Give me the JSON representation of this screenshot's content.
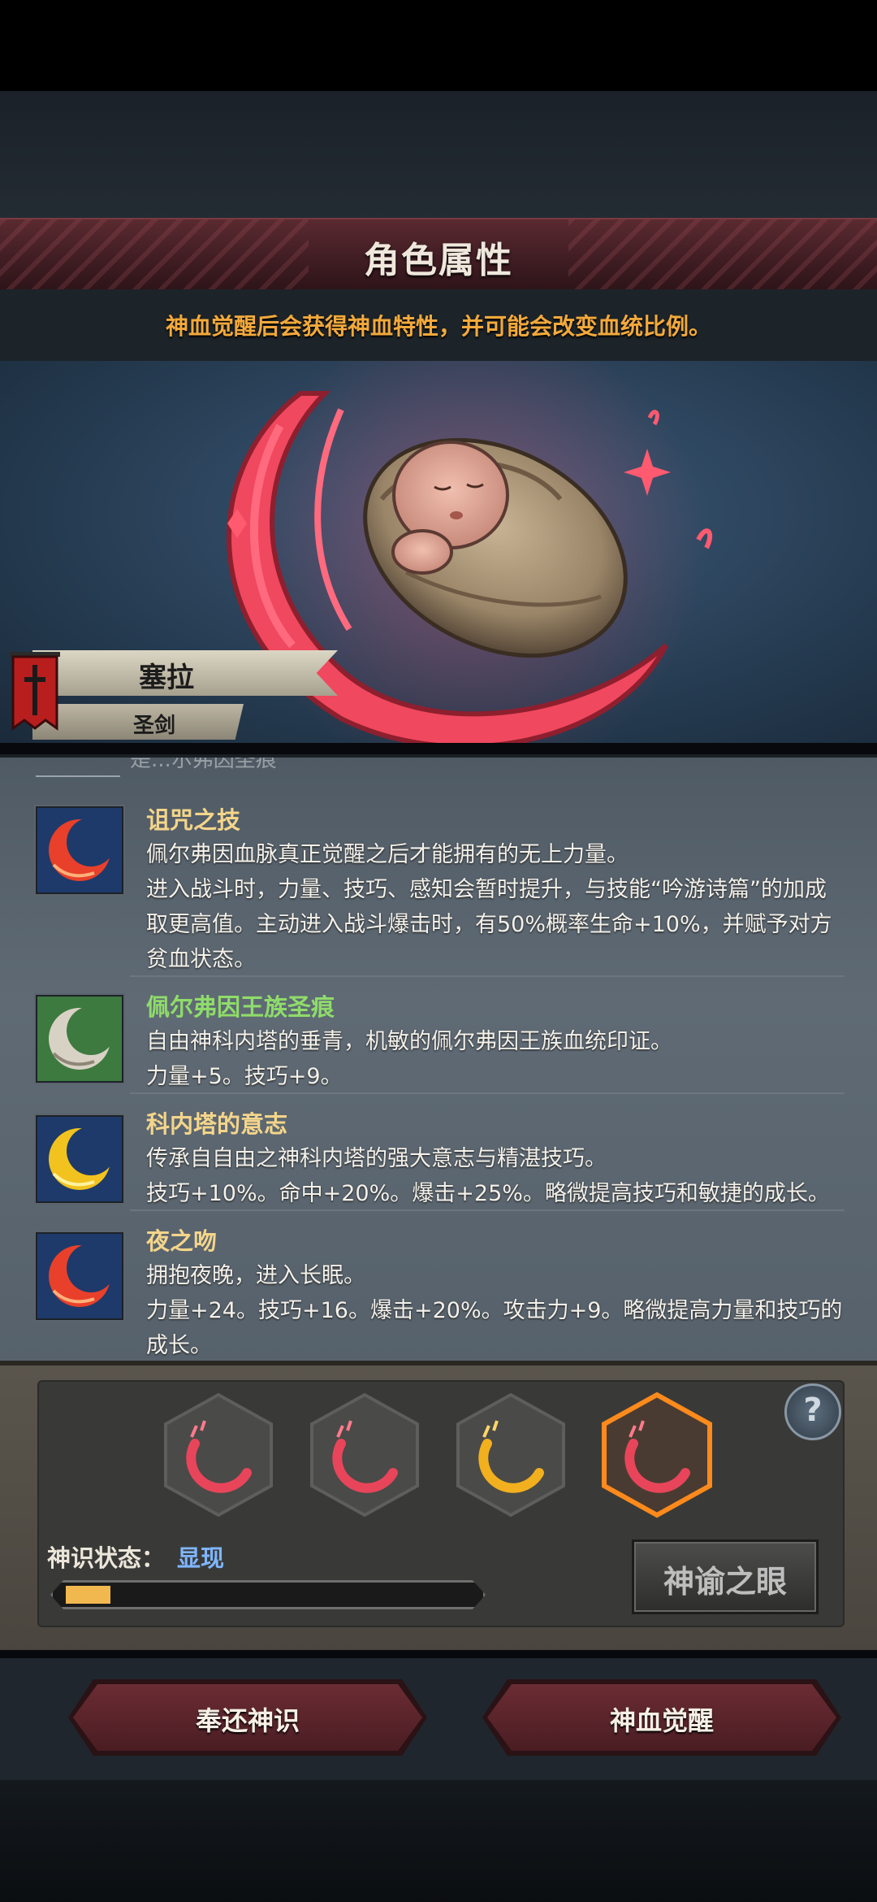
{
  "header": {
    "title": "角色属性",
    "hint": "神血觉醒后会获得神血特性，并可能会改变血统比例。"
  },
  "character": {
    "name": "塞拉",
    "class": "圣剑"
  },
  "traits_panel": {
    "faded_prev_line": "是...尔弗因圣痕",
    "traits": [
      {
        "name": "诅咒之技",
        "name_color": "#f4d58a",
        "icon": "red-flame-crescent-icon",
        "desc": "佩尔弗因血脉真正觉醒之后才能拥有的无上力量。\n进入战斗时，力量、技巧、感知会暂时提升，与技能“吟游诗篇”的加成取更高值。主动进入战斗爆击时，有50%概率生命+10%，并赋予对方贫血状态。"
      },
      {
        "name": "佩尔弗因王族圣痕",
        "name_color": "#8fdc6a",
        "icon": "white-flame-crescent-icon",
        "desc": "自由神科内塔的垂青，机敏的佩尔弗因王族血统印证。\n力量+5。技巧+9。"
      },
      {
        "name": "科内塔的意志",
        "name_color": "#f4d58a",
        "icon": "gold-flame-crescent-icon",
        "desc": "传承自自由之神科内塔的强大意志与精湛技巧。\n技巧+10%。命中+20%。爆击+25%。略微提高技巧和敏捷的成长。"
      },
      {
        "name": "夜之吻",
        "name_color": "#f4d58a",
        "icon": "red-flame-crescent-icon",
        "desc": "拥抱夜晚，进入长眠。\n力量+24。技巧+16。爆击+20%。攻击力+9。略微提高力量和技巧的成长。"
      }
    ]
  },
  "awakening": {
    "slots": [
      {
        "icon": "red-crescent-sigil-icon",
        "color": "#e8455a",
        "selected": false
      },
      {
        "icon": "red-crescent-sigil-icon",
        "color": "#e8455a",
        "selected": false
      },
      {
        "icon": "gold-crescent-sigil-icon",
        "color": "#f2b01e",
        "selected": false
      },
      {
        "icon": "red-crescent-sigil-icon",
        "color": "#e8455a",
        "selected": true
      }
    ],
    "help_icon": "?",
    "status_label": "神识状态：",
    "status_value": "显现",
    "progress": 0.11,
    "oracle_button": "神谕之眼"
  },
  "buttons": {
    "return": "奉还神识",
    "awaken": "神血觉醒"
  },
  "colors": {
    "accent_orange": "#f3a93b",
    "status_blue": "#7fb6ff",
    "highlight_orange": "#ff8a1c",
    "progress_yellow": "#f2b850"
  }
}
